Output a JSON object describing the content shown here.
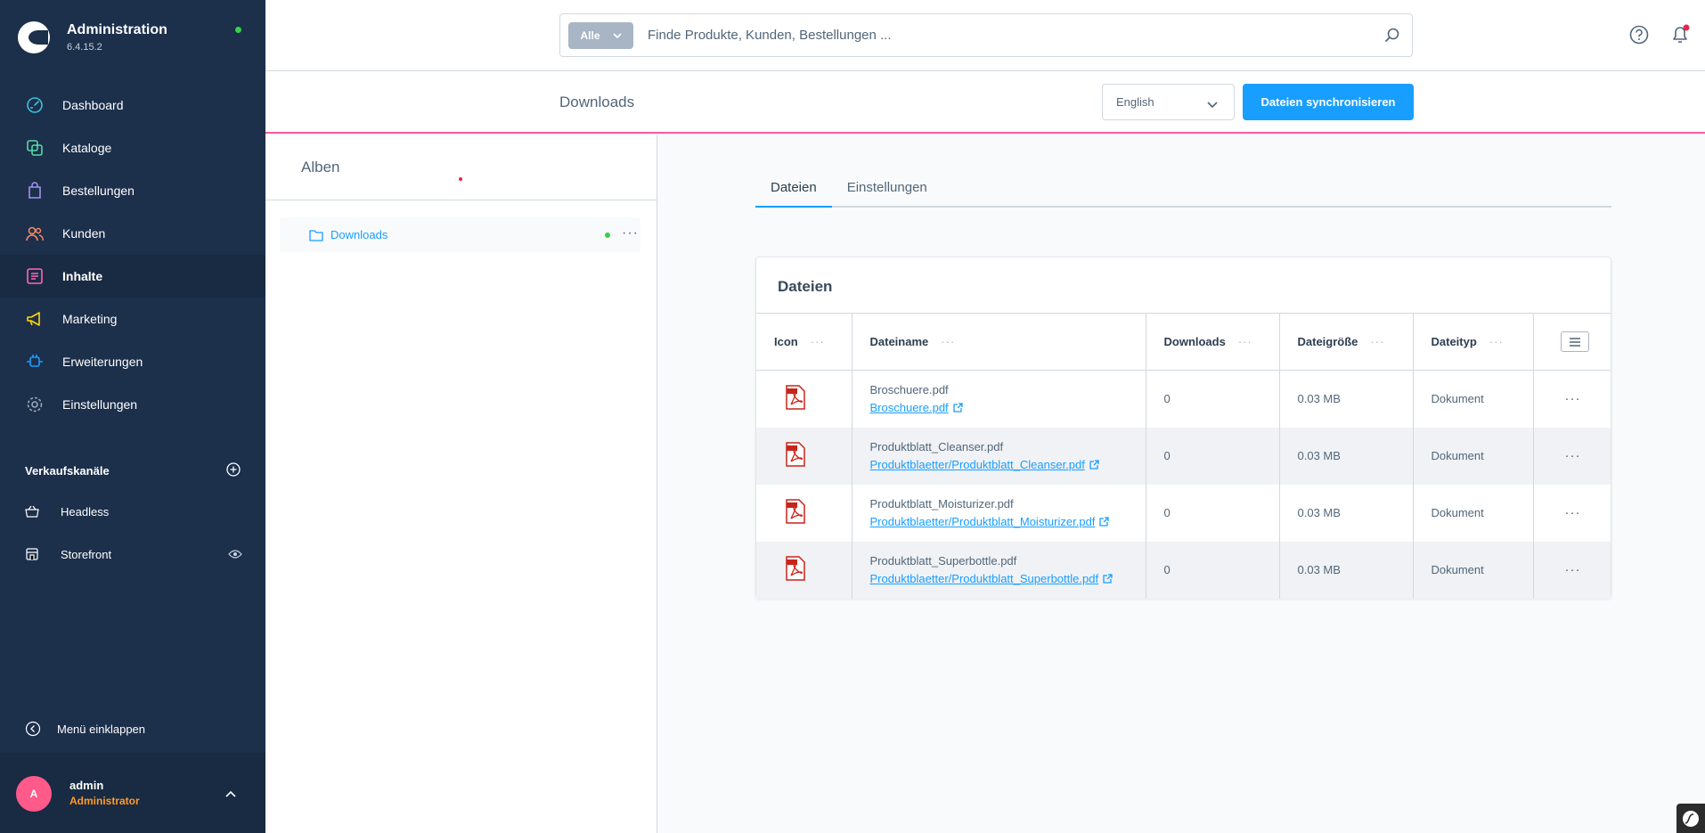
{
  "brand": {
    "title": "Administration",
    "version": "6.4.15.2"
  },
  "nav": [
    {
      "label": "Dashboard",
      "icon": "dashboard-icon",
      "color": "#3bc2dd"
    },
    {
      "label": "Kataloge",
      "icon": "catalogues-icon",
      "color": "#57d9a3"
    },
    {
      "label": "Bestellungen",
      "icon": "orders-icon",
      "color": "#a092f0"
    },
    {
      "label": "Kunden",
      "icon": "customers-icon",
      "color": "#f88962"
    },
    {
      "label": "Inhalte",
      "icon": "content-icon",
      "color": "#ff68b4",
      "active": true
    },
    {
      "label": "Marketing",
      "icon": "marketing-icon",
      "color": "#ffd700"
    },
    {
      "label": "Erweiterungen",
      "icon": "extensions-icon",
      "color": "#189eff"
    },
    {
      "label": "Einstellungen",
      "icon": "settings-icon",
      "color": "#9aa8b5"
    }
  ],
  "sales_channels": {
    "title": "Verkaufskanäle",
    "items": [
      {
        "label": "Headless",
        "icon": "basket-icon"
      },
      {
        "label": "Storefront",
        "icon": "storefront-icon"
      }
    ]
  },
  "collapse_label": "Menü einklappen",
  "user": {
    "initial": "A",
    "name": "admin",
    "role": "Administrator"
  },
  "search": {
    "type_label": "Alle",
    "placeholder": "Finde Produkte, Kunden, Bestellungen ..."
  },
  "smartbar": {
    "title": "Downloads",
    "language": "English",
    "sync_label": "Dateien synchronisieren"
  },
  "albums": {
    "title": "Alben",
    "items": [
      {
        "name": "Downloads"
      }
    ]
  },
  "tabs": [
    {
      "label": "Dateien",
      "active": true
    },
    {
      "label": "Einstellungen",
      "active": false
    }
  ],
  "files_card": {
    "title": "Dateien",
    "columns": [
      "Icon",
      "Dateiname",
      "Downloads",
      "Dateigröße",
      "Dateityp"
    ],
    "rows": [
      {
        "name": "Broschuere.pdf",
        "path": "Broschuere.pdf",
        "downloads": "0",
        "size": "0.03 MB",
        "type": "Dokument"
      },
      {
        "name": "Produktblatt_Cleanser.pdf",
        "path": "Produktblaetter/Produktblatt_Cleanser.pdf",
        "downloads": "0",
        "size": "0.03 MB",
        "type": "Dokument"
      },
      {
        "name": "Produktblatt_Moisturizer.pdf",
        "path": "Produktblaetter/Produktblatt_Moisturizer.pdf",
        "downloads": "0",
        "size": "0.03 MB",
        "type": "Dokument"
      },
      {
        "name": "Produktblatt_Superbottle.pdf",
        "path": "Produktblaetter/Produktblatt_Superbottle.pdf",
        "downloads": "0",
        "size": "0.03 MB",
        "type": "Dokument"
      }
    ]
  },
  "colors": {
    "sidebar": "#1c2f4b",
    "accent": "#189eff",
    "content_accent": "#ff5aa0",
    "pdf_red": "#c8251a"
  }
}
